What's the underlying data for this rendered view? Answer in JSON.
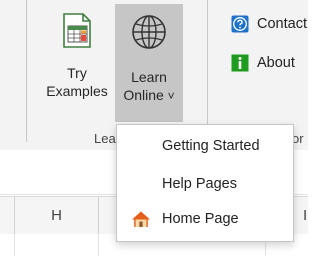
{
  "ribbon": {
    "try_examples": {
      "line1": "Try",
      "line2": "Examples"
    },
    "learn_online": {
      "line1": "Learn",
      "line2": "Online",
      "chevron": "˅"
    },
    "group_label_left": "Lea",
    "group_label_right": "or",
    "contact_label": "Contact",
    "about_label": "About"
  },
  "menu": {
    "items": [
      {
        "label": "Getting Started",
        "icon": ""
      },
      {
        "label": "Help Pages",
        "icon": ""
      },
      {
        "label": "Home Page",
        "icon": "home-icon"
      }
    ]
  },
  "sheet": {
    "columns": [
      "H",
      "I"
    ]
  },
  "colors": {
    "ribbon_bg": "#f3f3f3",
    "learn_online_selected_bg": "#c6c6c6",
    "contact_icon_blue": "#1e73c8",
    "about_icon_green": "#1f9b1f",
    "home_roof_orange": "#e35d1b"
  }
}
